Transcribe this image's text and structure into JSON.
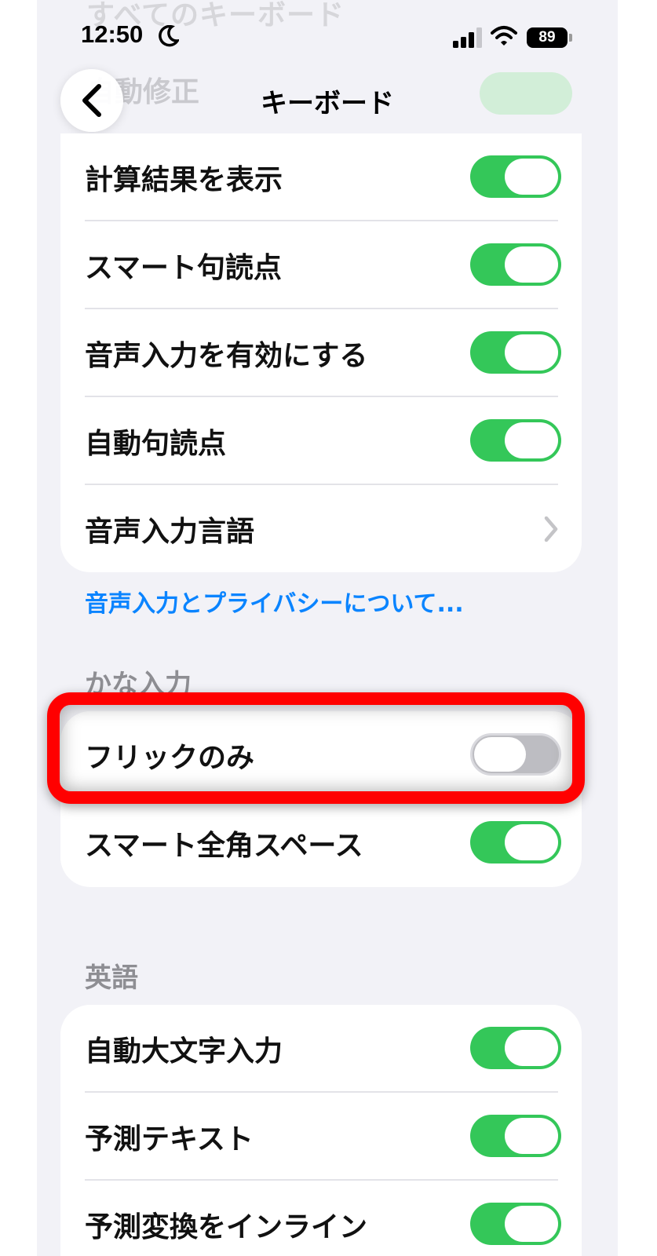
{
  "status_bar": {
    "time": "12:50",
    "battery": "89"
  },
  "nav": {
    "title": "キーボード"
  },
  "ghost": {
    "section_label": "すべてのキーボード",
    "row_label": "自動修正"
  },
  "group_main": {
    "rows": [
      {
        "label": "計算結果を表示",
        "toggle": "on"
      },
      {
        "label": "スマート句読点",
        "toggle": "on"
      },
      {
        "label": "音声入力を有効にする",
        "toggle": "on"
      },
      {
        "label": "自動句読点",
        "toggle": "on"
      },
      {
        "label": "音声入力言語",
        "accessory": "chevron-right-icon"
      }
    ],
    "footer_link": "音声入力とプライバシーについて..."
  },
  "group_kana": {
    "header": "かな入力",
    "rows": [
      {
        "label": "フリックのみ",
        "toggle": "off"
      },
      {
        "label": "スマート全角スペース",
        "toggle": "on"
      }
    ]
  },
  "group_english": {
    "header": "英語",
    "rows": [
      {
        "label": "自動大文字入力",
        "toggle": "on"
      },
      {
        "label": "予測テキスト",
        "toggle": "on"
      },
      {
        "label": "予測変換をインライン",
        "toggle": "on"
      }
    ]
  },
  "colors": {
    "toggle_on": "#34c759",
    "link": "#0a84ff",
    "highlight": "#ff0000"
  }
}
